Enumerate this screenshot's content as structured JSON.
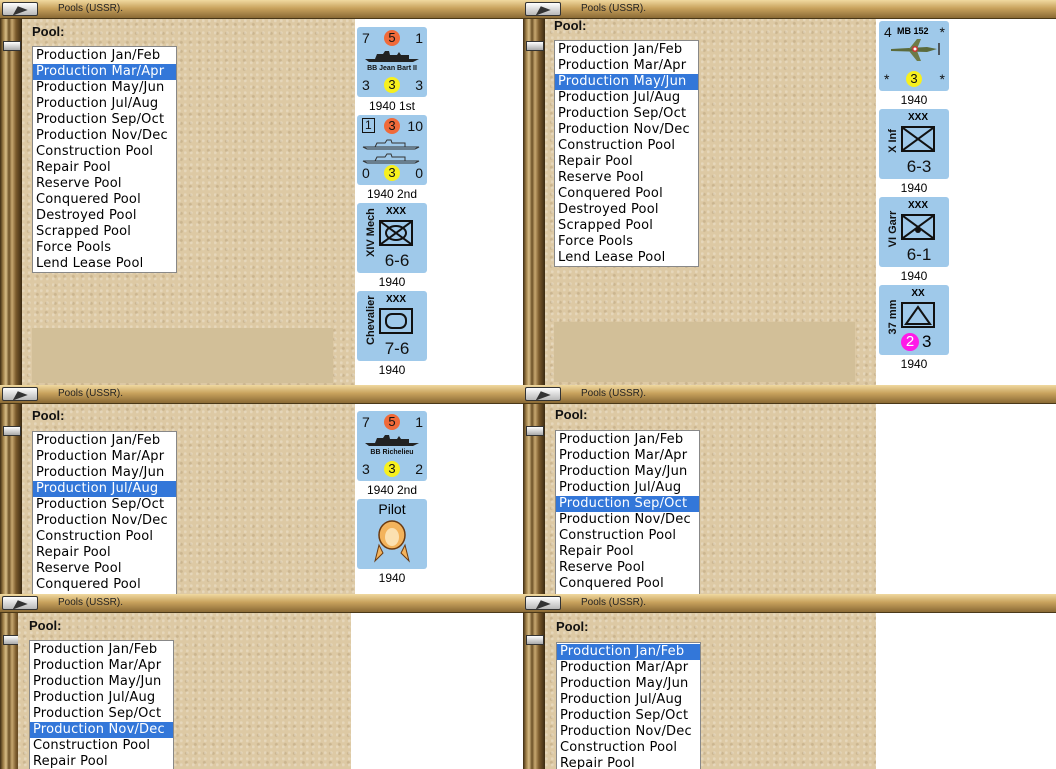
{
  "window_title": "Pools (USSR).",
  "pool_label": "Pool:",
  "list_items": [
    "Production Jan/Feb",
    "Production Mar/Apr",
    "Production May/Jun",
    "Production Jul/Aug",
    "Production Sep/Oct",
    "Production Nov/Dec",
    "Construction Pool",
    "Repair Pool",
    "Reserve Pool",
    "Conquered Pool",
    "Destroyed Pool",
    "Scrapped Pool",
    "Force Pools",
    "Lend Lease Pool"
  ],
  "panels": [
    {
      "selected": "Production Mar/Apr",
      "counters": [
        {
          "kind": "ship",
          "name": "BB Jean Bart II",
          "tl": "7",
          "tr": "1",
          "bl": "3",
          "br": "3",
          "top_badge": "5",
          "bottom_badge": "3",
          "caption": "1940 1st"
        },
        {
          "kind": "convoy",
          "tl": "1",
          "tr": "10",
          "bl": "0",
          "br": "0",
          "top_badge": "3",
          "bottom_badge": "3",
          "caption": "1940 2nd"
        },
        {
          "kind": "mech",
          "name": "XIV Mech",
          "size": "XXX",
          "strength": "6-6",
          "caption": "1940"
        },
        {
          "kind": "armor",
          "name": "Chevalier",
          "size": "XXX",
          "strength": "7-6",
          "caption": "1940"
        }
      ]
    },
    {
      "selected": "Production May/Jun",
      "counters": [
        {
          "kind": "plane",
          "name": "MB 152",
          "tl": "4",
          "tr": "*",
          "bl": "*",
          "br": "*",
          "bottom_badge": "3",
          "caption": "1940"
        },
        {
          "kind": "inf",
          "name": "X Inf",
          "size": "XXX",
          "strength": "6-3",
          "caption": "1940"
        },
        {
          "kind": "garr",
          "name": "VI Garr",
          "size": "XXX",
          "strength": "6-1",
          "caption": "1940"
        },
        {
          "kind": "aa",
          "name": "37 mm",
          "size": "XX",
          "badge": "2",
          "value": "3",
          "caption": "1940"
        }
      ]
    },
    {
      "selected": "Production Jul/Aug",
      "counters": [
        {
          "kind": "ship",
          "name": "BB Richelieu",
          "tl": "7",
          "tr": "1",
          "bl": "3",
          "br": "2",
          "top_badge": "5",
          "bottom_badge": "3",
          "caption": "1940 2nd"
        },
        {
          "kind": "pilot",
          "name": "Pilot",
          "caption": "1940"
        }
      ]
    },
    {
      "selected": "Production Sep/Oct",
      "counters": []
    },
    {
      "selected": "Production Nov/Dec",
      "counters": []
    },
    {
      "selected": "Production Jan/Feb",
      "counters": []
    }
  ]
}
